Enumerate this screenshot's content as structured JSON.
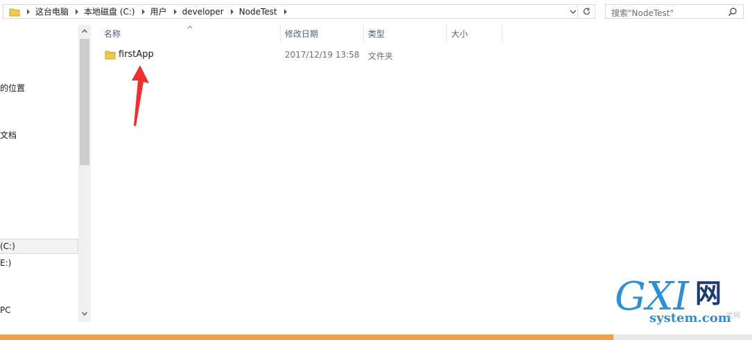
{
  "address_bar": {
    "crumbs": [
      "这台电脑",
      "本地磁盘 (C:)",
      "用户",
      "developer",
      "NodeTest"
    ]
  },
  "search": {
    "placeholder": "搜索\"NodeTest\""
  },
  "nav": {
    "items": [
      "的位置",
      "文档",
      "(C:)",
      "E:)",
      "PC"
    ],
    "selected_index": 2
  },
  "columns": [
    "名称",
    "修改日期",
    "类型",
    "大小"
  ],
  "files": [
    {
      "name": "firstApp",
      "modified": "2017/12/19 13:58",
      "type": "文件夹",
      "size": ""
    }
  ],
  "watermark": {
    "big": "GXI",
    "cn": "网",
    "site": "system.com",
    "small": "文网"
  },
  "colors": {
    "accent": "#2d8fd4",
    "annotation_arrow": "#f03030",
    "folder": "#f2c94c",
    "bottom_strip": "#f0a04b"
  }
}
